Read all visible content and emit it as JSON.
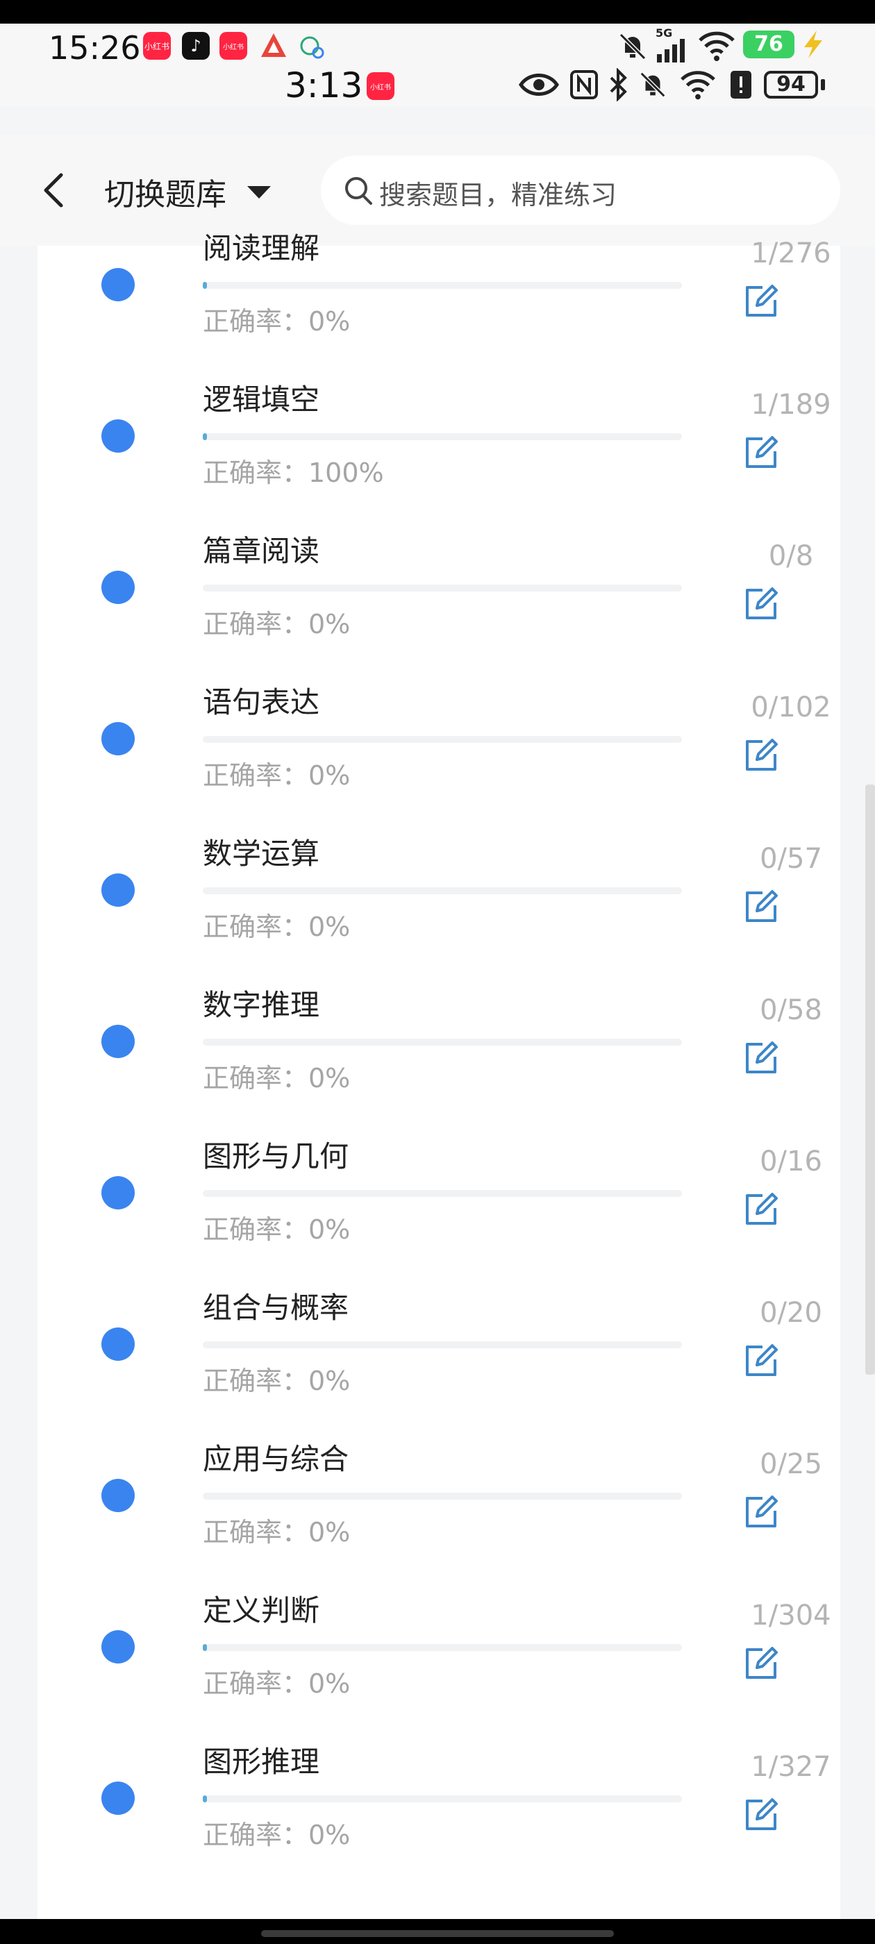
{
  "status_bar": {
    "time_primary": "15:26",
    "time_secondary": "3:13",
    "network": "5G",
    "battery_primary": "76",
    "battery_secondary": "94",
    "badge_red": "小红书",
    "colors": {
      "badge_red": "#ff2442",
      "battery_green": "#3bd062"
    }
  },
  "header": {
    "switch_label": "切换题库",
    "search_placeholder": "搜索题目，精准练习"
  },
  "colors": {
    "dot_blue": "#3a84f0",
    "edit_blue": "#3d86c8",
    "progress_fill": "#5aaad8"
  },
  "categories": [
    {
      "title": "阅读理解",
      "rate": "正确率：0%",
      "count": "1/276",
      "progress": 0.0036
    },
    {
      "title": "逻辑填空",
      "rate": "正确率：100%",
      "count": "1/189",
      "progress": 0.0053
    },
    {
      "title": "篇章阅读",
      "rate": "正确率：0%",
      "count": "0/8",
      "progress": 0
    },
    {
      "title": "语句表达",
      "rate": "正确率：0%",
      "count": "0/102",
      "progress": 0
    },
    {
      "title": "数学运算",
      "rate": "正确率：0%",
      "count": "0/57",
      "progress": 0
    },
    {
      "title": "数字推理",
      "rate": "正确率：0%",
      "count": "0/58",
      "progress": 0
    },
    {
      "title": "图形与几何",
      "rate": "正确率：0%",
      "count": "0/16",
      "progress": 0
    },
    {
      "title": "组合与概率",
      "rate": "正确率：0%",
      "count": "0/20",
      "progress": 0
    },
    {
      "title": "应用与综合",
      "rate": "正确率：0%",
      "count": "0/25",
      "progress": 0
    },
    {
      "title": "定义判断",
      "rate": "正确率：0%",
      "count": "1/304",
      "progress": 0.0033
    },
    {
      "title": "图形推理",
      "rate": "正确率：0%",
      "count": "1/327",
      "progress": 0.0031
    }
  ]
}
